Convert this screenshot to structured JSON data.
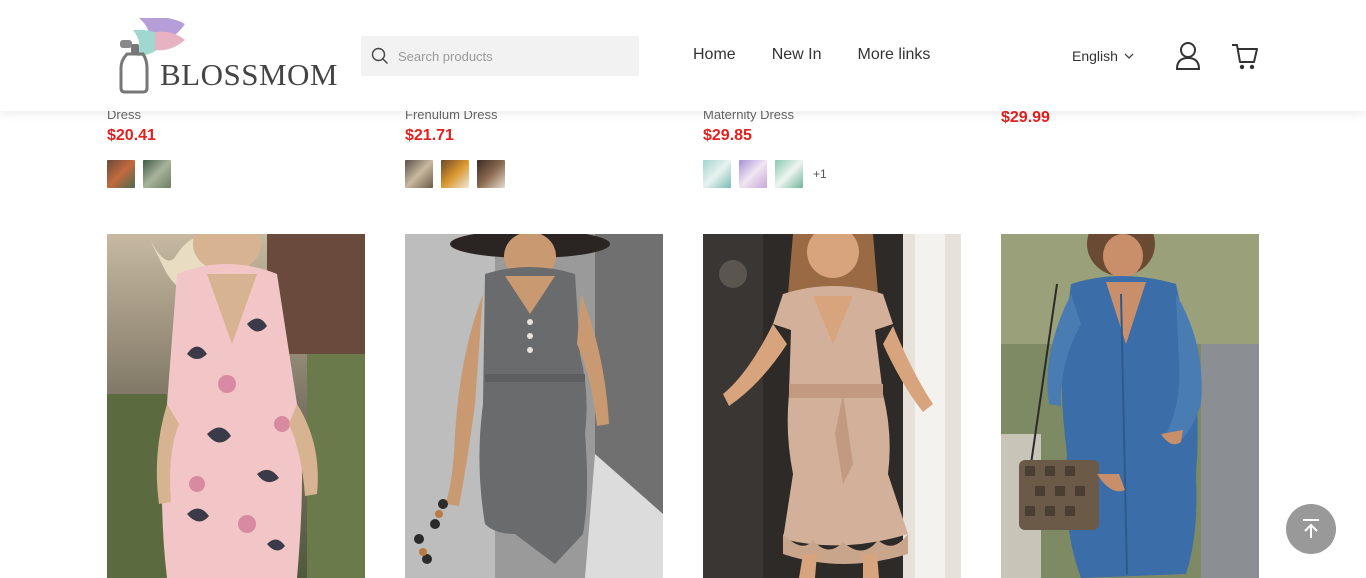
{
  "header": {
    "logo_text": "BLOSSMOM",
    "search_placeholder": "Search products",
    "nav": [
      "Home",
      "New In",
      "More links"
    ],
    "language": "English",
    "icons": [
      "user-icon",
      "cart-icon",
      "search-icon",
      "chevron-down-icon"
    ]
  },
  "previous_row": [
    {
      "title": "Dress",
      "price": "$20.41",
      "swatches": 2,
      "more": ""
    },
    {
      "title": "Frenulum Dress",
      "price": "$21.71",
      "swatches": 3,
      "more": ""
    },
    {
      "title": "Maternity Dress",
      "price": "$29.85",
      "swatches": 3,
      "more": "+1"
    },
    {
      "title": "",
      "price": "$29.99",
      "swatches": 0,
      "more": ""
    }
  ],
  "products": [
    {
      "image": "pink floral wrap maternity dress"
    },
    {
      "image": "grey sleeveless button maternity dress"
    },
    {
      "image": "beige ruffle sleeve tie waist maternity dress"
    },
    {
      "image": "blue denim shirt maternity dress"
    }
  ],
  "colors": {
    "price": "#e3211e",
    "back_to_top": "#999999"
  }
}
